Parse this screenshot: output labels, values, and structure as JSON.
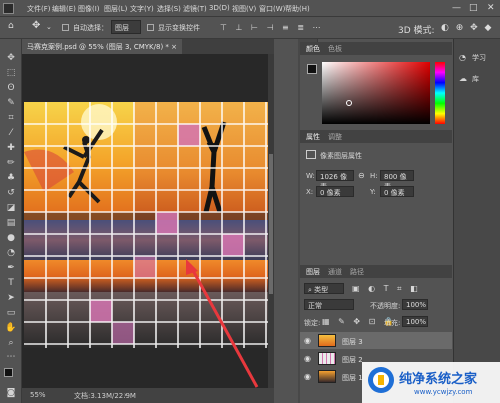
{
  "menu": {
    "items": [
      "文件(F)",
      "编辑(E)",
      "图像(I)",
      "图层(L)",
      "文字(Y)",
      "选择(S)",
      "滤镜(T)",
      "3D(D)",
      "视图(V)",
      "窗口(W)",
      "帮助(H)"
    ]
  },
  "options": {
    "auto_select_label": "自动选择：",
    "auto_select_value": "图层",
    "show_transform_label": "显示变换控件"
  },
  "document": {
    "tab_title": "马赛克案例.psd @ 55% (图层 3, CMYK/8) *",
    "zoom": "55%",
    "doc_info": "文档:3.13M/22.9M"
  },
  "color_panel": {
    "tab_color": "颜色",
    "tab_swatches": "色板"
  },
  "properties": {
    "tab_properties": "属性",
    "tab_adjust": "调整",
    "title": "像素图层属性",
    "w_label": "W:",
    "w_value": "1026 像素",
    "h_label": "H:",
    "h_value": "800 像素",
    "x_label": "X:",
    "x_value": "0 像素",
    "y_label": "Y:",
    "y_value": "0 像素"
  },
  "layers": {
    "tab_layers": "图层",
    "tab_channels": "通道",
    "tab_paths": "路径",
    "filter_type": "类型",
    "blend_mode": "正常",
    "opacity_label": "不透明度:",
    "opacity_value": "100%",
    "lock_label": "锁定:",
    "fill_label": "填充:",
    "fill_value": "100%",
    "items": [
      {
        "name": "图层 3"
      },
      {
        "name": "图层 2"
      },
      {
        "name": "图层 1"
      }
    ]
  },
  "right_dock": {
    "learn": "学习",
    "library": "库"
  },
  "watermark": {
    "title": "纯净系统之家",
    "url": "www.ycwjzy.com"
  },
  "colors": {
    "accent": "#e8383d",
    "ui_bg": "#535353",
    "panel_dark": "#424242"
  }
}
